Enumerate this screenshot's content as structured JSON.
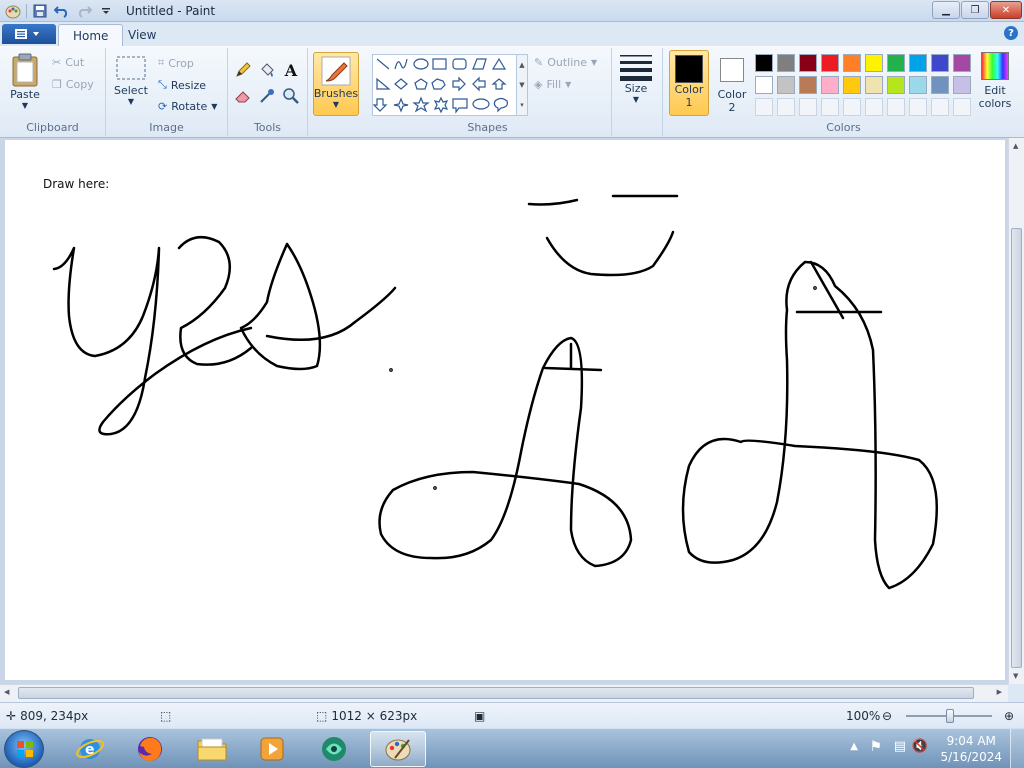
{
  "window": {
    "title": "Untitled - Paint"
  },
  "tabs": [
    {
      "label": "Home"
    },
    {
      "label": "View"
    }
  ],
  "ribbon": {
    "clipboard": {
      "label": "Clipboard",
      "paste": "Paste",
      "cut": "Cut",
      "copy": "Copy"
    },
    "image": {
      "label": "Image",
      "select": "Select",
      "crop": "Crop",
      "resize": "Resize",
      "rotate": "Rotate"
    },
    "tools": {
      "label": "Tools"
    },
    "brushes": {
      "label": "Brushes"
    },
    "shapes": {
      "label": "Shapes",
      "outline": "Outline",
      "fill": "Fill"
    },
    "size": {
      "label": "Size"
    },
    "colors": {
      "label": "Colors",
      "color1": "Color 1",
      "color1_a": "Color",
      "color1_b": "1",
      "color2_a": "Color",
      "color2_b": "2",
      "edit_a": "Edit",
      "edit_b": "colors",
      "color1_value": "#000000",
      "color2_value": "#ffffff",
      "palette_row1": [
        "#000000",
        "#7f7f7f",
        "#880015",
        "#ed1c24",
        "#ff7f27",
        "#fff200",
        "#22b14c",
        "#00a2e8",
        "#3f48cc",
        "#a349a4"
      ],
      "palette_row2": [
        "#ffffff",
        "#c3c3c3",
        "#b97a57",
        "#ffaec9",
        "#ffc90e",
        "#efe4b0",
        "#b5e61d",
        "#99d9ea",
        "#7092be",
        "#c8bfe7"
      ]
    }
  },
  "canvas": {
    "text": "Draw here:"
  },
  "status": {
    "cursor": "809, 234px",
    "size": "1012 × 623px",
    "zoom": "100%"
  },
  "taskbar": {
    "time": "9:04 AM",
    "date": "5/16/2024"
  }
}
